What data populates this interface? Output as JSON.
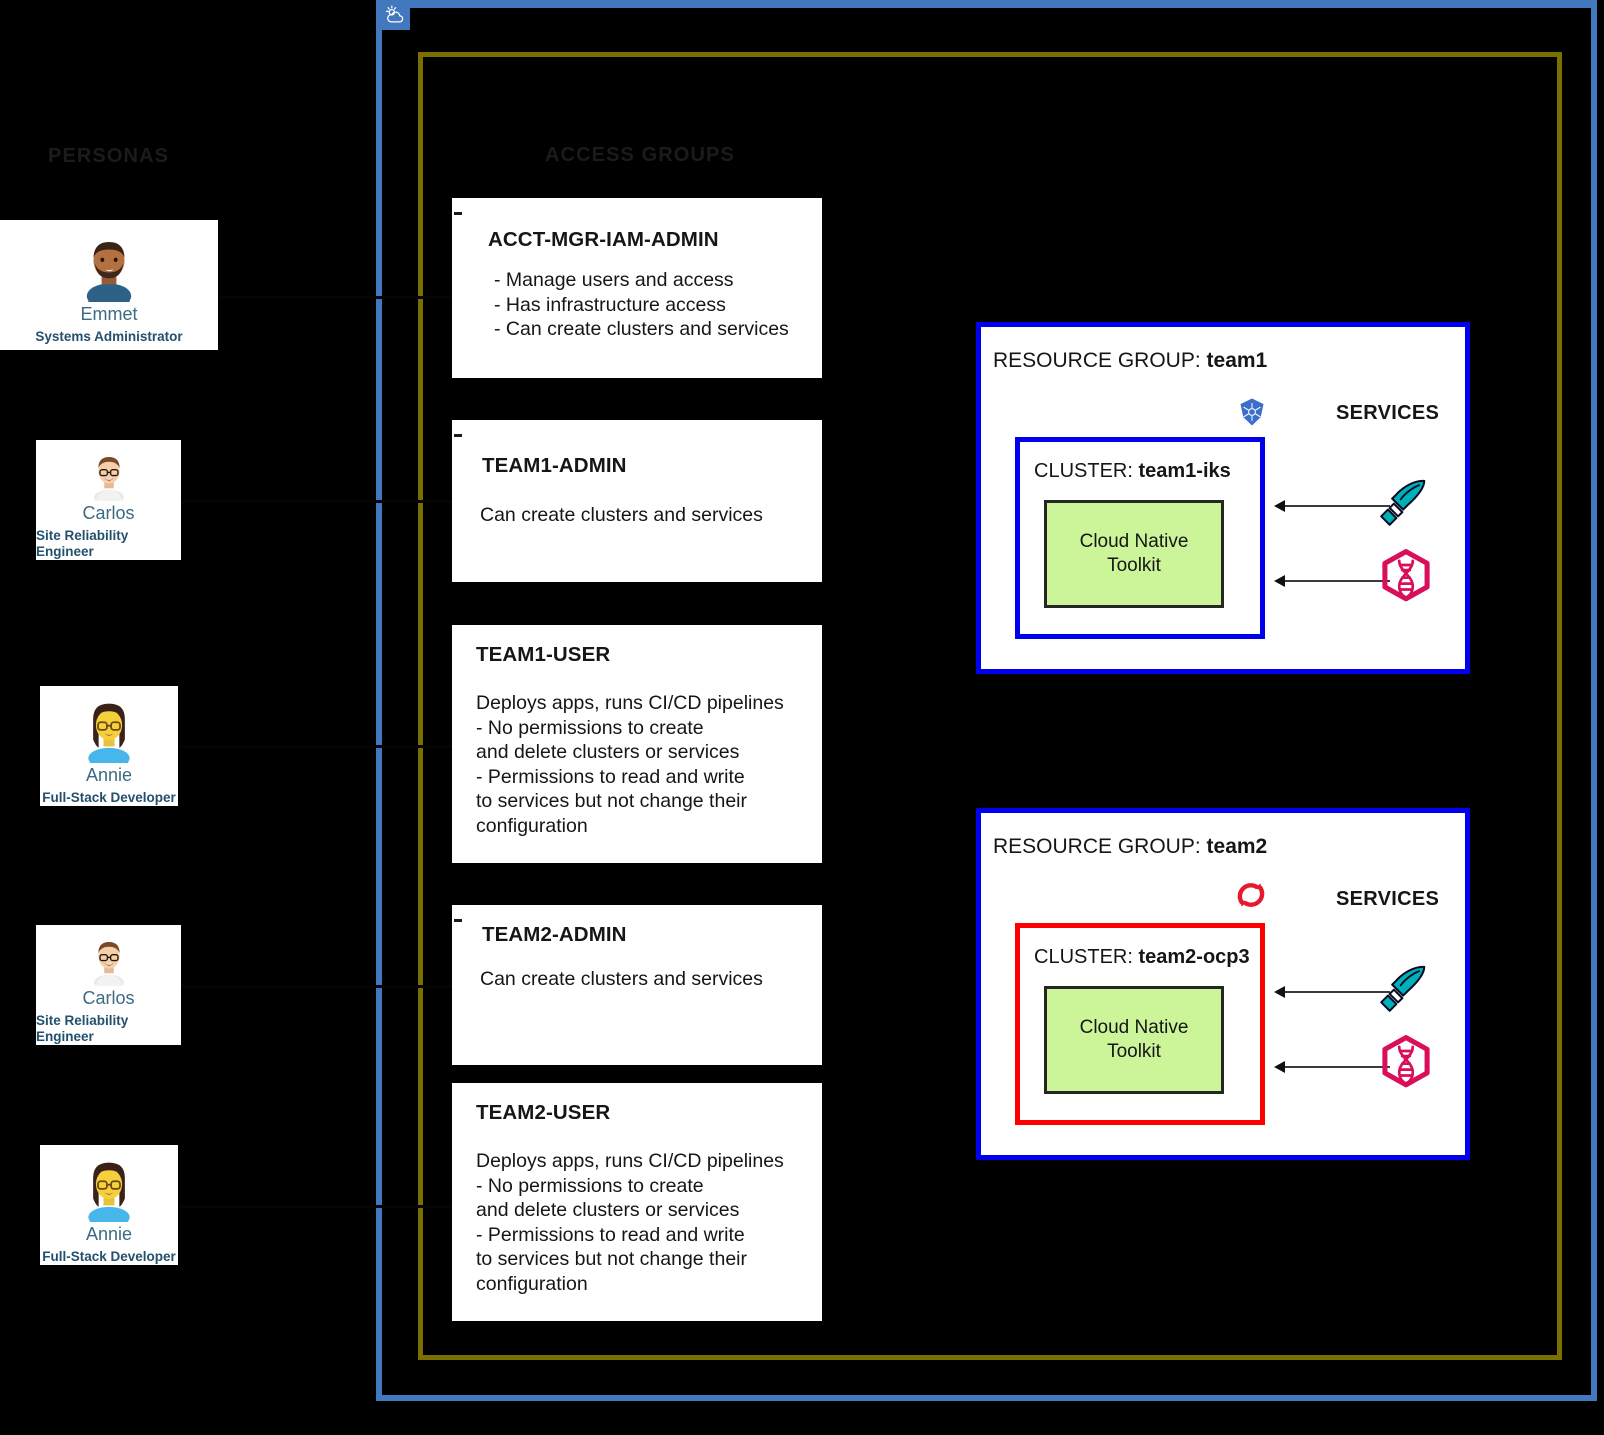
{
  "diagram": {
    "background_color": "#000000",
    "account_frame_color": "#4178be",
    "org_frame_color": "#7a7000",
    "cloud_badge_icon": "cloud-sun-icon"
  },
  "personas": {
    "title": "PERSONAS",
    "items": [
      {
        "name": "Emmet",
        "role": "Systems Administrator",
        "avatar": "avatar-emmet"
      },
      {
        "name": "Carlos",
        "role": "Site Reliability Engineer",
        "avatar": "avatar-carlos"
      },
      {
        "name": "Annie",
        "role": "Full-Stack Developer",
        "avatar": "avatar-annie"
      },
      {
        "name": "Carlos",
        "role": "Site Reliability Engineer",
        "avatar": "avatar-carlos"
      },
      {
        "name": "Annie",
        "role": "Full-Stack Developer",
        "avatar": "avatar-annie"
      }
    ]
  },
  "access_groups": {
    "title": "ACCESS GROUPS",
    "items": [
      {
        "name": "ACCT-MGR-IAM-ADMIN",
        "body": "- Manage users and access\n- Has infrastructure access\n- Can create clusters and services"
      },
      {
        "name": "TEAM1-ADMIN",
        "body": "Can create clusters and services"
      },
      {
        "name": "TEAM1-USER",
        "body": "Deploys apps, runs CI/CD pipelines\n- No permissions to create\nand delete clusters or services\n- Permissions to read and write\nto services but not change their\nconfiguration"
      },
      {
        "name": "TEAM2-ADMIN",
        "body": "Can create clusters and services"
      },
      {
        "name": "TEAM2-USER",
        "body": "Deploys apps, runs CI/CD pipelines\n- No permissions to create\nand delete clusters or services\n- Permissions to read and write\nto services but not change their\nconfiguration"
      }
    ]
  },
  "resource_groups": [
    {
      "prefix": "RESOURCE GROUP: ",
      "name": "team1",
      "platform_icon": "kubernetes-icon",
      "platform_color": "#3d6ecc",
      "services_label": "SERVICES",
      "cluster": {
        "prefix": "CLUSTER: ",
        "name": "team1-iks",
        "border_color": "#0000ee",
        "toolkit_label": "Cloud Native\nToolkit"
      },
      "services": [
        {
          "icon": "trowel-icon",
          "color": "#00b0b9"
        },
        {
          "icon": "dna-hexagon-icon",
          "color": "#d90f5a"
        }
      ]
    },
    {
      "prefix": "RESOURCE GROUP: ",
      "name": "team2",
      "platform_icon": "openshift-icon",
      "platform_color": "#e8192c",
      "services_label": "SERVICES",
      "cluster": {
        "prefix": "CLUSTER: ",
        "name": "team2-ocp3",
        "border_color": "#ff0000",
        "toolkit_label": "Cloud Native\nToolkit"
      },
      "services": [
        {
          "icon": "trowel-icon",
          "color": "#00b0b9"
        },
        {
          "icon": "dna-hexagon-icon",
          "color": "#d90f5a"
        }
      ]
    }
  ]
}
